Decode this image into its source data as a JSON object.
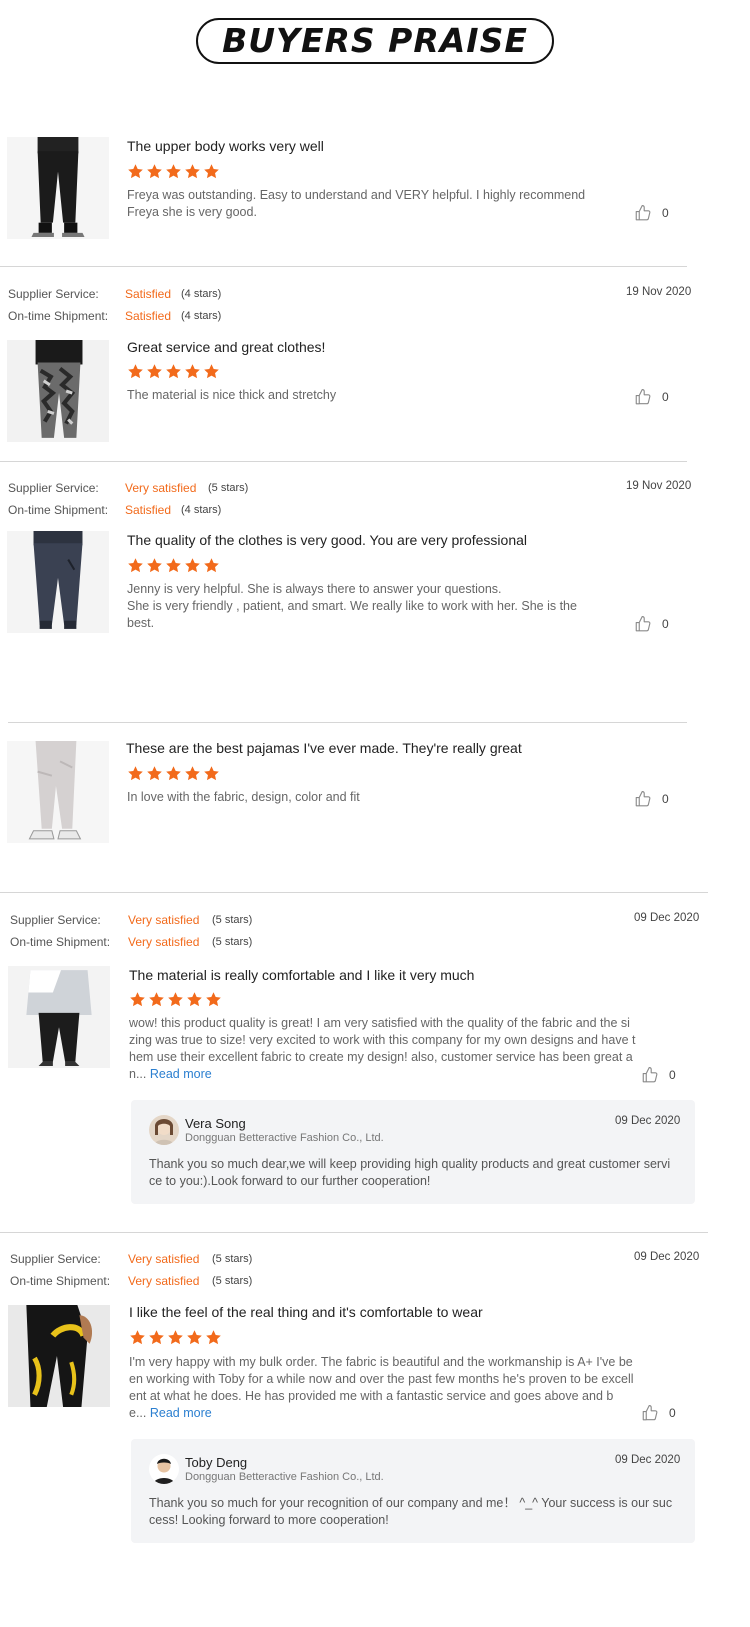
{
  "header": {
    "title": "BUYERS PRAISE"
  },
  "labels": {
    "supplier_service": "Supplier Service:",
    "on_time_shipment": "On-time Shipment:",
    "read_more": "Read more"
  },
  "colors": {
    "accent": "#f26a1b",
    "link": "#2b7fd0",
    "divider": "#d6d6d6",
    "reply_bg": "#f3f4f6"
  },
  "reviews": [
    {
      "title": "The upper body works very well",
      "rating": 5,
      "text": "Freya was outstanding. Easy to understand and VERY helpful. I highly recommend\nFreya she is very good.",
      "likes": "0",
      "thumb": "black-joggers-image"
    },
    {
      "supplier_service": "Satisfied",
      "supplier_stars": "(4 stars)",
      "shipment": "Satisfied",
      "shipment_stars": "(4 stars)",
      "date": "19 Nov 2020",
      "title": "Great service and great clothes!",
      "rating": 5,
      "text": "The material is nice thick and stretchy",
      "likes": "0",
      "thumb": "camo-leggings-image"
    },
    {
      "supplier_service": "Very satisfied",
      "supplier_stars": "(5 stars)",
      "shipment": "Satisfied",
      "shipment_stars": "(4 stars)",
      "date": "19 Nov 2020",
      "title": "The quality of the clothes is very good. You are very professional",
      "rating": 5,
      "text": "Jenny is very helpful. She is always there to answer your questions.\nShe is  very friendly , patient, and smart. We really like to work with her. She is the\nbest.",
      "likes": "0",
      "thumb": "navy-joggers-image"
    },
    {
      "title": "These are the best pajamas I've ever made. They're really great",
      "rating": 5,
      "text": "In love with the fabric, design,  color and fit",
      "likes": "0",
      "thumb": "grey-joggers-image"
    },
    {
      "supplier_service": "Very satisfied",
      "supplier_stars": "(5 stars)",
      "shipment": "Very satisfied",
      "shipment_stars": "(5 stars)",
      "date": "09 Dec 2020",
      "title": "The material is really comfortable and I like it very much",
      "rating": 5,
      "text": "wow! this product quality is great! I am very satisfied with the quality of the fabric and the si\nzing was true to size! very excited to work with this company for my own designs and have t\nhem use their excellent fabric to create my design! also, customer service has been great a\nn...",
      "likes": "0",
      "thumb": "colorblock-tracksuit-image",
      "reply": {
        "name": "Vera Song",
        "company": "Dongguan Betteractive Fashion Co., Ltd.",
        "date": "09 Dec 2020",
        "text": "Thank you so much dear,we will keep providing high quality products and great customer servi\nce to you:).Look forward to our further cooperation!"
      }
    },
    {
      "supplier_service": "Very satisfied",
      "supplier_stars": "(5 stars)",
      "shipment": "Very satisfied",
      "shipment_stars": "(5 stars)",
      "date": "09 Dec 2020",
      "title": "I like the feel of the real thing and it's comfortable to wear",
      "rating": 5,
      "text": "I'm very happy with my bulk order. The fabric is beautiful and the workmanship is A+ I've be\nen working with Toby for a while now and over the past few months he's proven to be excell\nent at what he does. He has provided me with a fantastic service and goes above and b\ne...",
      "likes": "0",
      "thumb": "yellow-black-tights-image",
      "reply": {
        "name": "Toby Deng",
        "company": "Dongguan Betteractive Fashion Co., Ltd.",
        "date": "09 Dec 2020",
        "text": "Thank you so much for your recognition of our company and me！ ^_^ Your success is our suc\ncess! Looking forward to more cooperation!"
      }
    }
  ]
}
